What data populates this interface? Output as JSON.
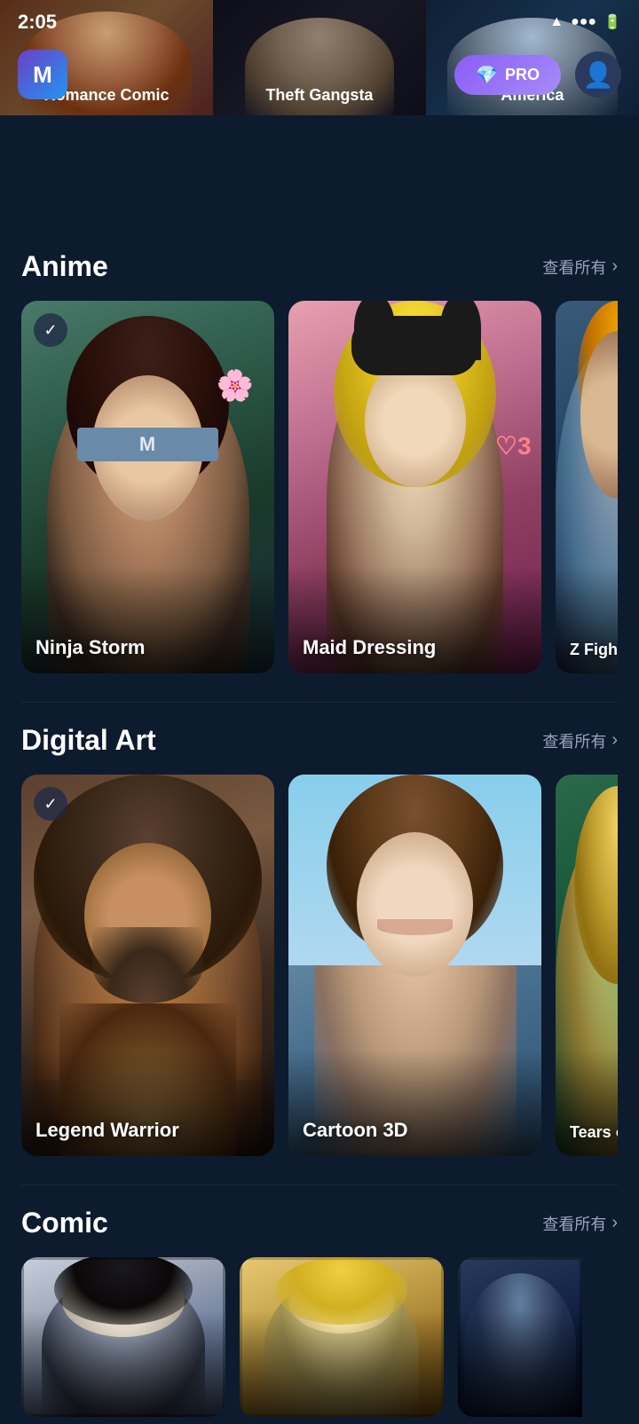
{
  "statusBar": {
    "time": "2:05",
    "wifiIcon": "wifi-icon",
    "signalIcon": "signal-icon",
    "batteryIcon": "battery-icon"
  },
  "header": {
    "logoText": "M",
    "proBadgeLabel": "PRO",
    "gemIcon": "gem-icon",
    "avatarIcon": "user-icon"
  },
  "carousel": {
    "items": [
      {
        "label": "Romance Comic",
        "bg": "carousel-bg-1"
      },
      {
        "label": "Theft Gangsta",
        "bg": "carousel-bg-2"
      },
      {
        "label": "America",
        "bg": "carousel-bg-3"
      }
    ]
  },
  "sections": [
    {
      "id": "anime",
      "title": "Anime",
      "viewAllLabel": "查看所有",
      "cards": [
        {
          "label": "Ninja Storm",
          "bg": "bg-ninja",
          "hasBookmark": true
        },
        {
          "label": "Maid Dressing",
          "bg": "bg-maid",
          "hasBookmark": false
        },
        {
          "label": "Z Fighter",
          "bg": "bg-zfighter",
          "hasBookmark": false
        }
      ]
    },
    {
      "id": "digital-art",
      "title": "Digital Art",
      "viewAllLabel": "查看所有",
      "cards": [
        {
          "label": "Legend Warrior",
          "bg": "bg-legend",
          "hasBookmark": true
        },
        {
          "label": "Cartoon 3D",
          "bg": "bg-cartoon3d",
          "hasBookmark": false
        },
        {
          "label": "Tears of",
          "bg": "bg-tears",
          "hasBookmark": false
        }
      ]
    },
    {
      "id": "comic",
      "title": "Comic",
      "viewAllLabel": "查看所有",
      "cards": [
        {
          "label": "",
          "bg": "bg-comic1",
          "hasBookmark": false
        },
        {
          "label": "",
          "bg": "bg-comic2",
          "hasBookmark": false
        },
        {
          "label": "",
          "bg": "bg-comic3",
          "hasBookmark": false
        }
      ]
    }
  ]
}
